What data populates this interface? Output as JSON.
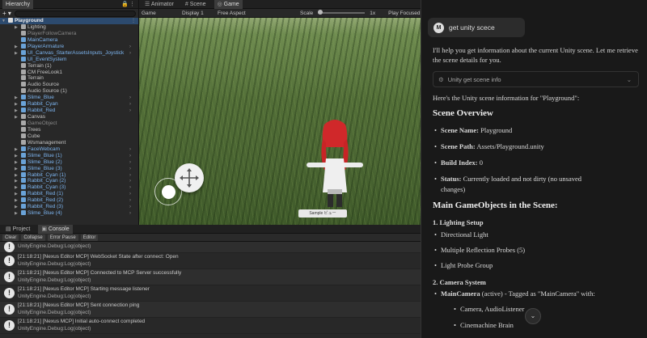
{
  "hierarchy": {
    "tab": "Hierarchy",
    "add_label": "+ ▾",
    "rows": [
      {
        "label": "Playground",
        "type": "root",
        "indent": 0,
        "arrow": true
      },
      {
        "label": "Lighting",
        "type": "normal",
        "indent": 1,
        "arrow": true
      },
      {
        "label": "PlayerFollowCamera",
        "type": "dim",
        "indent": 1,
        "arrow": false
      },
      {
        "label": "MainCamera",
        "type": "prefab",
        "indent": 1,
        "arrow": false
      },
      {
        "label": "PlayerArmature",
        "type": "prefab",
        "indent": 1,
        "arrow": true
      },
      {
        "label": "UI_Canvas_StarterAssetsInputs_Joystick",
        "type": "prefab",
        "indent": 1,
        "arrow": true
      },
      {
        "label": "UI_EventSystem",
        "type": "prefab",
        "indent": 1,
        "arrow": false
      },
      {
        "label": "Terrain (1)",
        "type": "normal",
        "indent": 1,
        "arrow": false
      },
      {
        "label": "CM FreeLook1",
        "type": "normal",
        "indent": 1,
        "arrow": false
      },
      {
        "label": "Terrain",
        "type": "normal",
        "indent": 1,
        "arrow": false
      },
      {
        "label": "Audio Source",
        "type": "normal",
        "indent": 1,
        "arrow": false
      },
      {
        "label": "Audio Source (1)",
        "type": "normal",
        "indent": 1,
        "arrow": false
      },
      {
        "label": "Slime_Blue",
        "type": "prefab",
        "indent": 1,
        "arrow": true
      },
      {
        "label": "Rabbit_Cyan",
        "type": "prefab",
        "indent": 1,
        "arrow": true
      },
      {
        "label": "Rabbit_Red",
        "type": "prefab",
        "indent": 1,
        "arrow": true
      },
      {
        "label": "Canvas",
        "type": "normal",
        "indent": 1,
        "arrow": true
      },
      {
        "label": "GameObject",
        "type": "dim",
        "indent": 1,
        "arrow": false
      },
      {
        "label": "Trees",
        "type": "normal",
        "indent": 1,
        "arrow": false
      },
      {
        "label": "Cube",
        "type": "normal",
        "indent": 1,
        "arrow": false
      },
      {
        "label": "Wsmanagement",
        "type": "normal",
        "indent": 1,
        "arrow": false
      },
      {
        "label": "FaceWebcam",
        "type": "prefab",
        "indent": 1,
        "arrow": true
      },
      {
        "label": "Slime_Blue (1)",
        "type": "prefab",
        "indent": 1,
        "arrow": true
      },
      {
        "label": "Slime_Blue (2)",
        "type": "prefab",
        "indent": 1,
        "arrow": true
      },
      {
        "label": "Slime_Blue (3)",
        "type": "prefab",
        "indent": 1,
        "arrow": true
      },
      {
        "label": "Rabbit_Cyan (1)",
        "type": "prefab",
        "indent": 1,
        "arrow": true
      },
      {
        "label": "Rabbit_Cyan (2)",
        "type": "prefab",
        "indent": 1,
        "arrow": true
      },
      {
        "label": "Rabbit_Cyan (3)",
        "type": "prefab",
        "indent": 1,
        "arrow": true
      },
      {
        "label": "Rabbit_Red (1)",
        "type": "prefab",
        "indent": 1,
        "arrow": true
      },
      {
        "label": "Rabbit_Red (2)",
        "type": "prefab",
        "indent": 1,
        "arrow": true
      },
      {
        "label": "Rabbit_Red (3)",
        "type": "prefab",
        "indent": 1,
        "arrow": true
      },
      {
        "label": "Slime_Blue (4)",
        "type": "prefab",
        "indent": 1,
        "arrow": true
      }
    ]
  },
  "game": {
    "tabs": [
      "Animator",
      "Scene",
      "Game"
    ],
    "toolbar": {
      "display_mode": "Game",
      "display": "Display 1",
      "aspect": "Free Aspect",
      "scale_label": "Scale",
      "scale_value": "1x",
      "play_focused": "Play Focused"
    },
    "badge": "Sample ビュー"
  },
  "console": {
    "tabs": [
      "Project",
      "Console"
    ],
    "buttons": [
      "Clear",
      "Collapse",
      "Error Pause",
      "Editor"
    ],
    "entries": [
      {
        "l1": "",
        "l2": "UnityEngine.Debug:Log(object)"
      },
      {
        "l1": "[21:18:21] [Nexus Editor MCP] WebSocket State after connect: Open",
        "l2": "UnityEngine.Debug:Log(object)"
      },
      {
        "l1": "[21:18:21] [Nexus Editor MCP] Connected to MCP Server successfully",
        "l2": "UnityEngine.Debug:Log(object)"
      },
      {
        "l1": "[21:18:21] [Nexus Editor MCP] Starting message listener",
        "l2": "UnityEngine.Debug:Log(object)"
      },
      {
        "l1": "[21:18:21] [Nexus Editor MCP] Sent connection ping",
        "l2": "UnityEngine.Debug:Log(object)"
      },
      {
        "l1": "[21:18:21] [Nexus MCP] Initial auto-connect completed",
        "l2": "UnityEngine.Debug:Log(object)"
      }
    ]
  },
  "chat": {
    "user_avatar": "M",
    "user_message": "get unity scece",
    "intro": "I'll help you get information about the current Unity scene. Let me retrieve the scene details for you.",
    "tool_label": "Unity get scene info",
    "summary": "Here's the Unity scene information for \"Playground\":",
    "h_overview": "Scene Overview",
    "overview": [
      {
        "k": "Scene Name:",
        "v": " Playground"
      },
      {
        "k": "Scene Path:",
        "v": " Assets/Playground.unity"
      },
      {
        "k": "Build Index:",
        "v": " 0"
      },
      {
        "k": "Status:",
        "v": " Currently loaded and not dirty (no unsaved"
      }
    ],
    "status_cont": "changes)",
    "h_main": "Main GameObjects in the Scene:",
    "s1": "1. Lighting Setup",
    "lighting": [
      "Directional Light",
      "Multiple Reflection Probes (5)",
      "Light Probe Group"
    ],
    "s2": "2. Camera System",
    "camera_name": "MainCamera",
    "camera_rest": " (active) - Tagged as \"MainCamera\" with:",
    "camera_items": [
      "Camera, AudioListener",
      "Cinemachine Brain"
    ],
    "scroll_icon": "chevron-down-icon"
  }
}
